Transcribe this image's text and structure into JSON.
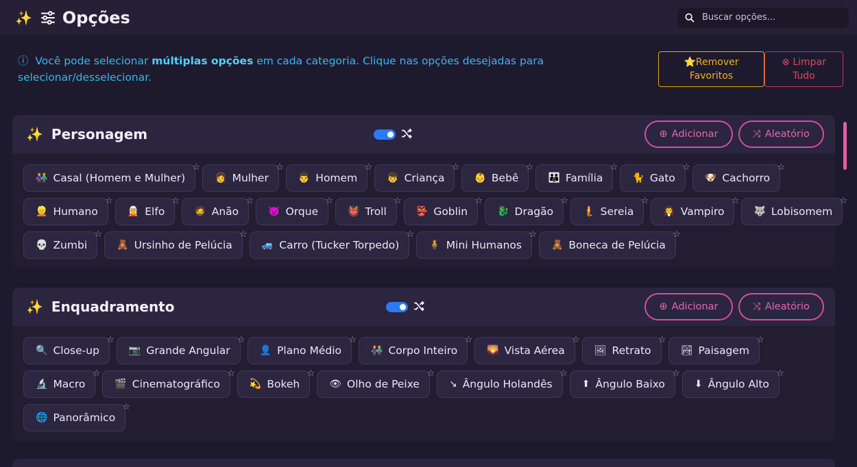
{
  "header": {
    "title": "Opções",
    "search_placeholder": "Buscar opções..."
  },
  "info": {
    "text_before": "Você pode selecionar ",
    "text_bold": "múltiplas opções",
    "text_after": " em cada categoria. Clique nas opções desejadas para selecionar/desselecionar."
  },
  "actions": {
    "favorites_line1": "Remover",
    "favorites_line2": "Favoritos",
    "clear_line1": "Limpar",
    "clear_line2": "Tudo"
  },
  "sections": [
    {
      "title": "Personagem",
      "add_label": "Adicionar",
      "random_label": "Aleatório",
      "rows": [
        [
          {
            "emoji": "👫",
            "label": "Casal (Homem e Mulher)"
          },
          {
            "emoji": "👩",
            "label": "Mulher"
          },
          {
            "emoji": "👨",
            "label": "Homem"
          },
          {
            "emoji": "👦",
            "label": "Criança"
          },
          {
            "emoji": "👶",
            "label": "Bebê"
          },
          {
            "emoji": "👪",
            "label": "Família"
          },
          {
            "emoji": "🐈",
            "label": "Gato"
          },
          {
            "emoji": "🐶",
            "label": "Cachorro"
          }
        ],
        [
          {
            "emoji": "👱",
            "label": "Humano"
          },
          {
            "emoji": "🧝",
            "label": "Elfo"
          },
          {
            "emoji": "🧔",
            "label": "Anão"
          },
          {
            "emoji": "👿",
            "label": "Orque"
          },
          {
            "emoji": "👹",
            "label": "Troll"
          },
          {
            "emoji": "👺",
            "label": "Goblin"
          },
          {
            "emoji": "🐉",
            "label": "Dragão"
          },
          {
            "emoji": "🧜",
            "label": "Sereia"
          },
          {
            "emoji": "🧛",
            "label": "Vampiro"
          },
          {
            "emoji": "🐺",
            "label": "Lobisomem"
          }
        ],
        [
          {
            "emoji": "💀",
            "label": "Zumbi"
          },
          {
            "emoji": "🧸",
            "label": "Ursinho de Pelúcia"
          },
          {
            "emoji": "🚙",
            "label": "Carro (Tucker Torpedo)"
          },
          {
            "emoji": "🧍",
            "label": "Mini Humanos"
          },
          {
            "emoji": "🧸",
            "label": "Boneca de Pelúcia"
          }
        ]
      ]
    },
    {
      "title": "Enquadramento",
      "add_label": "Adicionar",
      "random_label": "Aleatório",
      "rows": [
        [
          {
            "emoji": "🔍",
            "label": "Close-up"
          },
          {
            "emoji": "📷",
            "label": "Grande Angular"
          },
          {
            "emoji": "👤",
            "label": "Plano Médio"
          },
          {
            "emoji": "👫",
            "label": "Corpo Inteiro"
          },
          {
            "emoji": "🌄",
            "label": "Vista Aérea"
          },
          {
            "emoji": "🖼",
            "label": "Retrato"
          },
          {
            "emoji": "🏞",
            "label": "Paisagem"
          }
        ],
        [
          {
            "emoji": "🔬",
            "label": "Macro"
          },
          {
            "emoji": "🎬",
            "label": "Cinematográfico"
          },
          {
            "emoji": "💫",
            "label": "Bokeh"
          },
          {
            "emoji": "👁",
            "label": "Olho de Peixe"
          },
          {
            "emoji": "↘",
            "label": "Ângulo Holandês"
          },
          {
            "emoji": "⬆",
            "label": "Ângulo Baixo"
          },
          {
            "emoji": "⬇",
            "label": "Ângulo Alto"
          }
        ],
        [
          {
            "emoji": "🌐",
            "label": "Panorâmico"
          }
        ]
      ]
    }
  ]
}
